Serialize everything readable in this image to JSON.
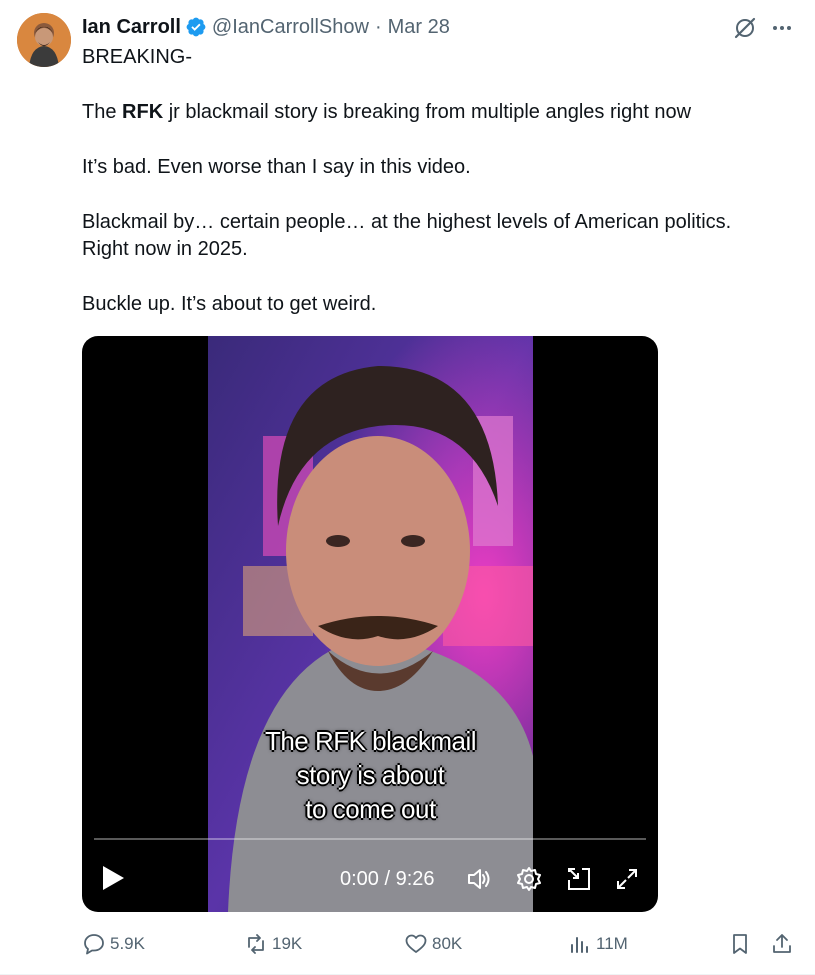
{
  "tweet": {
    "author_name": "Ian Carroll",
    "handle": "@IanCarrollShow",
    "separator": "·",
    "date": "Mar 28",
    "lines": {
      "l1": "BREAKING-",
      "l2_pre": "The ",
      "l2_bold": "RFK",
      "l2_post": " jr blackmail story is breaking from multiple angles right now",
      "l3": "It’s bad. Even worse than I say in this video.",
      "l4a": "Blackmail by… certain people… at the highest levels of American politics.",
      "l4b": "Right now in 2025.",
      "l5": "Buckle up. It’s about to get weird."
    }
  },
  "video": {
    "caption_lines": [
      "The RFK blackmail",
      "story is about",
      "to come out"
    ],
    "time": "0:00 / 9:26"
  },
  "actions": {
    "replies": "5.9K",
    "reposts": "19K",
    "likes": "80K",
    "views": "11M"
  },
  "colors": {
    "text": "#0f1419",
    "secondary": "#536471",
    "verified": "#1d9bf0"
  },
  "icons": [
    "verified-badge-icon",
    "grok-icon",
    "more-icon",
    "play-icon",
    "volume-icon",
    "settings-icon",
    "minimize-icon",
    "fullscreen-icon",
    "reply-icon",
    "repost-icon",
    "like-icon",
    "views-icon",
    "bookmark-icon",
    "share-icon"
  ]
}
